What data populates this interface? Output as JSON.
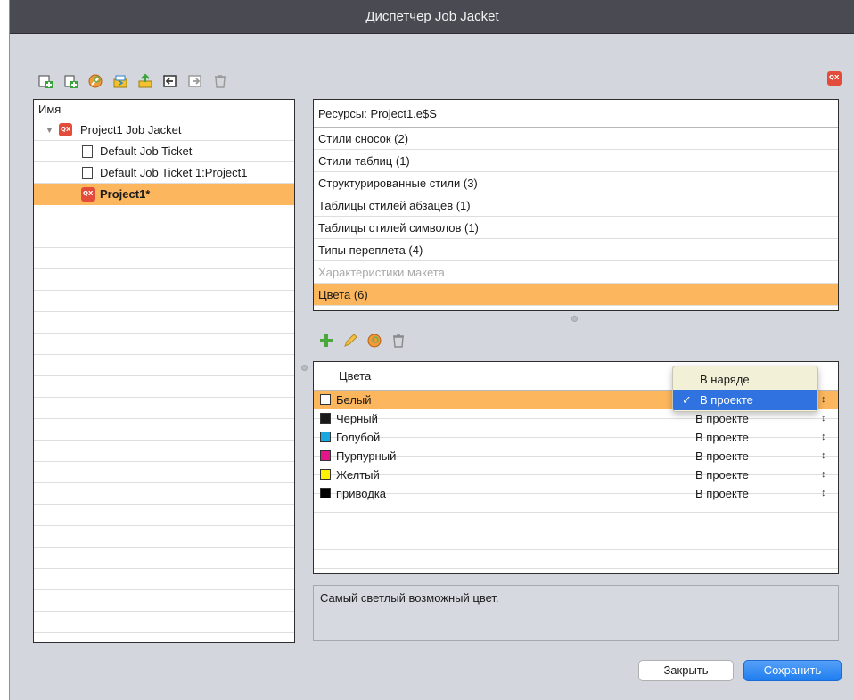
{
  "window": {
    "title": "Диспетчер Job Jacket"
  },
  "toolbar": {
    "icons": [
      "new-job-jacket-icon",
      "new-ticket-icon",
      "edit-icon",
      "import-icon",
      "export-icon",
      "link-icon",
      "unlink-icon",
      "trash-icon"
    ],
    "right_icon": "qx-project-icon"
  },
  "tree": {
    "header": "Имя",
    "items": [
      {
        "label": "Project1 Job Jacket",
        "icon": "job-jacket-icon",
        "expanded": true
      },
      {
        "label": "Default Job Ticket",
        "icon": "document-icon"
      },
      {
        "label": "Default Job Ticket 1:Project1",
        "icon": "document-icon"
      },
      {
        "label": "Project1*",
        "icon": "qx-project-icon",
        "selected": true
      }
    ]
  },
  "resources": {
    "header": "Ресурсы: Project1.e$S",
    "items": [
      {
        "label": "Стили сносок (2)"
      },
      {
        "label": "Стили таблиц (1)"
      },
      {
        "label": "Структурированные стили (3)"
      },
      {
        "label": "Таблицы стилей абзацев (1)"
      },
      {
        "label": "Таблицы стилей символов (1)"
      },
      {
        "label": "Типы переплета (4)"
      },
      {
        "label": "Характеристики макета",
        "disabled": true
      },
      {
        "label": "Цвета (6)",
        "selected": true
      }
    ]
  },
  "colors_toolbar": {
    "icons": [
      "add-icon",
      "edit-pencil-icon",
      "duplicate-icon",
      "trash-icon"
    ]
  },
  "colors": {
    "header": "Цвета",
    "rows": [
      {
        "name": "Белый",
        "swatch": "#ffffff",
        "value": "В проекте",
        "selected": true
      },
      {
        "name": "Черный",
        "swatch": "#1a1a1a",
        "value": "В проекте"
      },
      {
        "name": "Голубой",
        "swatch": "#19a9e0",
        "value": "В проекте"
      },
      {
        "name": "Пурпурный",
        "swatch": "#e2158a",
        "value": "В проекте"
      },
      {
        "name": "Желтый",
        "swatch": "#fff200",
        "value": "В проекте"
      },
      {
        "name": "приводка",
        "swatch": "#000000",
        "value": "В проекте"
      }
    ]
  },
  "dropdown": {
    "options": [
      {
        "label": "В наряде",
        "checked": false
      },
      {
        "label": "В проекте",
        "checked": true
      }
    ],
    "check_mark": "✓"
  },
  "description": "Самый светлый возможный цвет.",
  "buttons": {
    "close": "Закрыть",
    "save": "Сохранить"
  },
  "accent_colors": {
    "selection": "#fcb75e",
    "primary_button": "#1f7ef0",
    "menu_highlight": "#2f72e0"
  }
}
